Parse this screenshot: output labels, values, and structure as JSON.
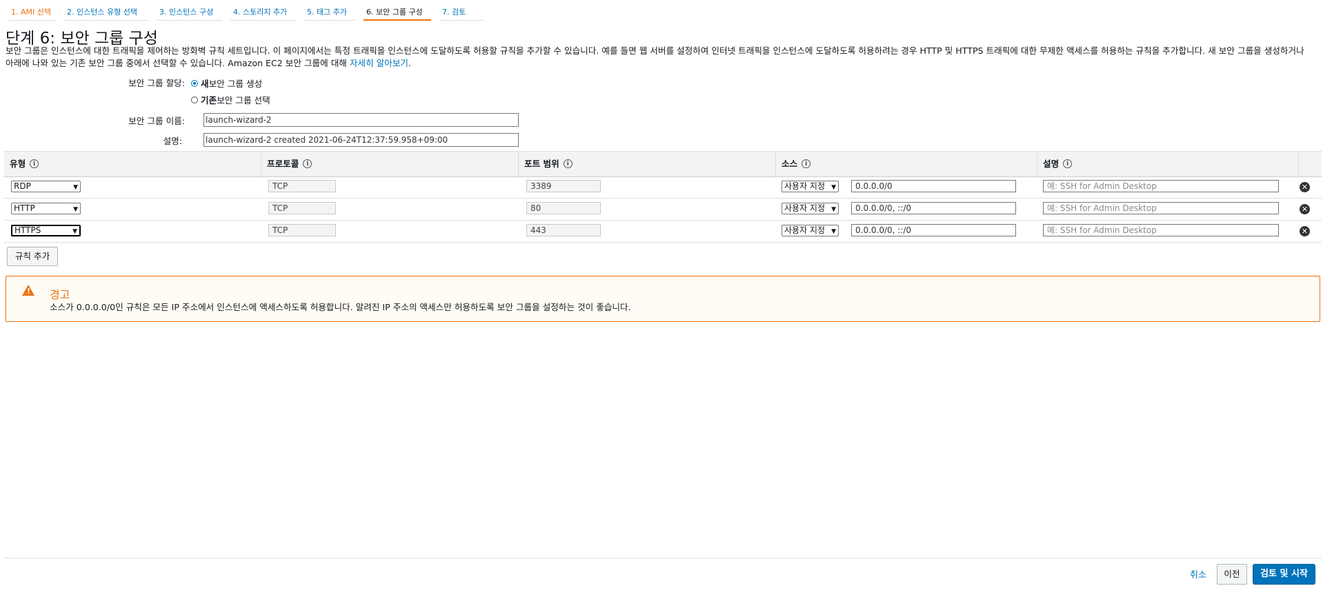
{
  "wizard": {
    "steps": [
      {
        "label": "1. AMI 선택"
      },
      {
        "label": "2. 인스턴스 유형 선택"
      },
      {
        "label": "3. 인스턴스 구성"
      },
      {
        "label": "4. 스토리지 추가"
      },
      {
        "label": "5. 태그 추가"
      },
      {
        "label": "6. 보안 그룹 구성"
      },
      {
        "label": "7. 검토"
      }
    ],
    "current_step": 6
  },
  "page": {
    "title": "단계 6: 보안 그룹 구성",
    "description": "보안 그룹은 인스턴스에 대한 트래픽을 제어하는 방화벽 규칙 세트입니다. 이 페이지에서는 특정 트래픽을 인스턴스에 도달하도록 허용할 규칙을 추가할 수 있습니다. 예를 들면 웹 서버를 설정하여 인터넷 트래픽을 인스턴스에 도달하도록 허용하려는 경우 HTTP 및 HTTPS 트래픽에 대한 무제한 액세스를 허용하는 규칙을 추가합니다. 새 보안 그룹을 생성하거나 아래에 나와 있는 기존 보안 그룹 중에서 선택할 수 있습니다. Amazon EC2 보안 그룹에 대해",
    "learn_more": "자세히 알아보기",
    "period": "."
  },
  "form": {
    "assign_label": "보안 그룹 할당:",
    "option_new": "새 보안 그룹 생성",
    "option_new_bold": "새",
    "option_new_rest": " 보안 그룹 생성",
    "option_existing_bold": "기존",
    "option_existing_rest": " 보안 그룹 선택",
    "selected_option": "new",
    "name_label": "보안 그룹 이름:",
    "name_value": "launch-wizard-2",
    "desc_label": "설명:",
    "desc_value": "launch-wizard-2 created 2021-06-24T12:37:59.958+09:00"
  },
  "table": {
    "headers": {
      "type": "유형",
      "protocol": "프로토콜",
      "port_range": "포트 범위",
      "source": "소스",
      "description": "설명"
    },
    "info_glyph": "i",
    "rows": [
      {
        "type": "RDP",
        "protocol": "TCP",
        "port": "3389",
        "source_type": "사용자 지정",
        "source": "0.0.0.0/0",
        "desc_placeholder": "예: SSH for Admin Desktop"
      },
      {
        "type": "HTTP",
        "protocol": "TCP",
        "port": "80",
        "source_type": "사용자 지정",
        "source": "0.0.0.0/0, ::/0",
        "desc_placeholder": "예: SSH for Admin Desktop"
      },
      {
        "type": "HTTPS",
        "protocol": "TCP",
        "port": "443",
        "source_type": "사용자 지정",
        "source": "0.0.0.0/0, ::/0",
        "desc_placeholder": "예: SSH for Admin Desktop"
      }
    ],
    "add_rule_label": "규칙 추가"
  },
  "warning": {
    "title": "경고",
    "text": "소스가 0.0.0.0/0인 규칙은 모든 IP 주소에서 인스턴스에 액세스하도록 허용합니다. 알려진 IP 주소의 액세스만 허용하도록 보안 그룹을 설정하는 것이 좋습니다."
  },
  "footer": {
    "cancel": "취소",
    "previous": "이전",
    "review_launch": "검토 및 시작"
  },
  "colors": {
    "accent_orange": "#ec7211",
    "link_blue": "#0073bb",
    "primary_button": "#0073bb"
  }
}
